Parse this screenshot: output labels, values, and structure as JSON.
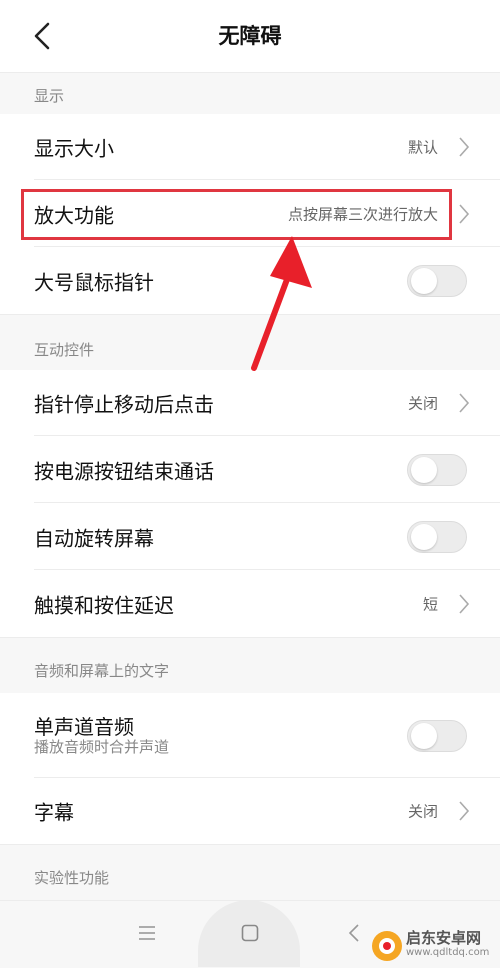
{
  "header": {
    "title": "无障碍"
  },
  "sections": {
    "display": {
      "title": "显示"
    },
    "interaction": {
      "title": "互动控件"
    },
    "audio": {
      "title": "音频和屏幕上的文字"
    },
    "experimental": {
      "title": "实验性功能"
    }
  },
  "rows": {
    "display_size": {
      "label": "显示大小",
      "value": "默认"
    },
    "magnification": {
      "label": "放大功能",
      "value": "点按屏幕三次进行放大"
    },
    "large_pointer": {
      "label": "大号鼠标指针",
      "toggle": "off"
    },
    "dwell_click": {
      "label": "指针停止移动后点击",
      "value": "关闭"
    },
    "power_end_call": {
      "label": "按电源按钮结束通话",
      "toggle": "off"
    },
    "auto_rotate": {
      "label": "自动旋转屏幕",
      "toggle": "off"
    },
    "touch_delay": {
      "label": "触摸和按住延迟",
      "value": "短"
    },
    "mono_audio": {
      "label": "单声道音频",
      "sublabel": "播放音频时合并声道",
      "toggle": "off"
    },
    "captions": {
      "label": "字幕",
      "value": "关闭"
    }
  },
  "watermark": {
    "text": "启东安卓网",
    "url": "www.qdltdq.com"
  },
  "colors": {
    "highlight": "#e03640",
    "divider": "#ececec",
    "section_bg": "#f7f7f7"
  }
}
